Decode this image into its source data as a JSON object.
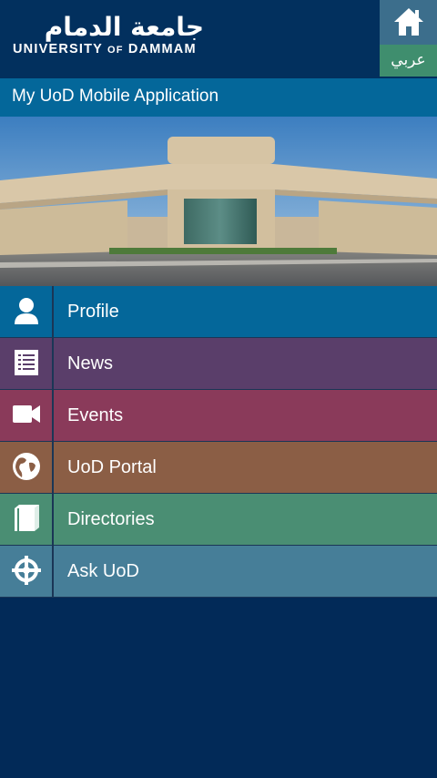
{
  "header": {
    "logo_arabic": "جامعة الدمام",
    "logo_english_1": "UNIVERSITY ",
    "logo_english_of": "OF",
    "logo_english_2": " DAMMAM",
    "home_icon": "home-icon",
    "language_label": "عربي"
  },
  "appbar": {
    "title": "My UoD Mobile Application"
  },
  "hero": {
    "description_icon": "campus-gate-photo"
  },
  "menu": {
    "items": [
      {
        "label": "Profile",
        "icon": "user-icon",
        "color": "#04679A"
      },
      {
        "label": "News",
        "icon": "news-list-icon",
        "color": "#5A3E6A"
      },
      {
        "label": "Events",
        "icon": "video-camera-icon",
        "color": "#8A3A5A"
      },
      {
        "label": "UoD Portal",
        "icon": "globe-icon",
        "color": "#8B5E45"
      },
      {
        "label": "Directories",
        "icon": "book-icon",
        "color": "#4A8E73"
      },
      {
        "label": "Ask UoD",
        "icon": "help-target-icon",
        "color": "#467E98"
      }
    ]
  },
  "colors": {
    "background": "#022A58",
    "header": "#02305E",
    "appbar": "#04679A",
    "home_button": "#3C6E8C",
    "language_button": "#3F8E6E"
  }
}
